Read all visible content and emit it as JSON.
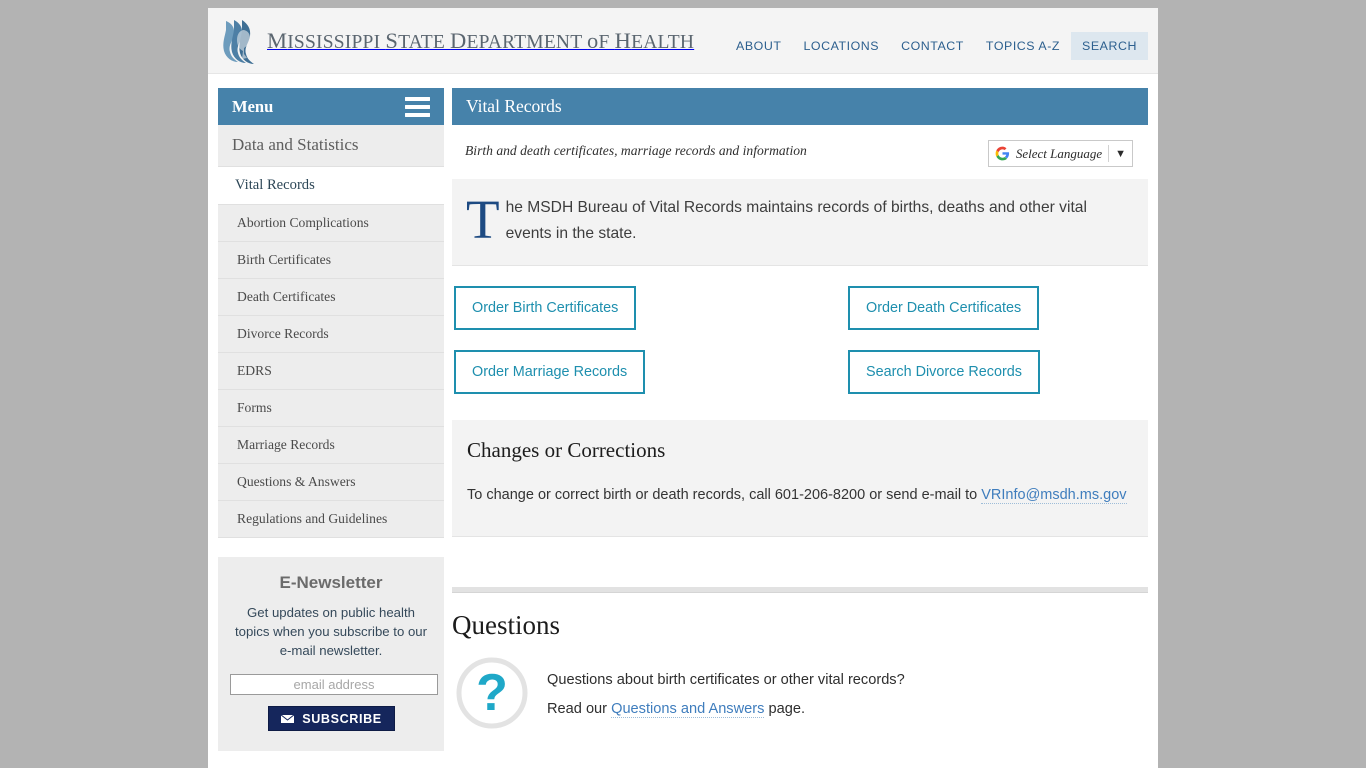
{
  "header": {
    "brand": "Mississippi State Department of Health",
    "nav": [
      {
        "label": "ABOUT",
        "active": false
      },
      {
        "label": "LOCATIONS",
        "active": false
      },
      {
        "label": "CONTACT",
        "active": false
      },
      {
        "label": "TOPICS A-Z",
        "active": false
      },
      {
        "label": "SEARCH",
        "active": true
      }
    ]
  },
  "sidebar": {
    "menu_label": "Menu",
    "section_title": "Data and Statistics",
    "items": [
      {
        "label": "Vital Records",
        "current": true
      },
      {
        "label": "Abortion Complications",
        "current": false
      },
      {
        "label": "Birth Certificates",
        "current": false
      },
      {
        "label": "Death Certificates",
        "current": false
      },
      {
        "label": "Divorce Records",
        "current": false
      },
      {
        "label": "EDRS",
        "current": false
      },
      {
        "label": "Forms",
        "current": false
      },
      {
        "label": "Marriage Records",
        "current": false
      },
      {
        "label": "Questions & Answers",
        "current": false
      },
      {
        "label": "Regulations and Guidelines",
        "current": false
      }
    ],
    "newsletter": {
      "title": "E-Newsletter",
      "description": "Get updates on public health topics when you subscribe to our e-mail newsletter.",
      "email_placeholder": "email address",
      "email_value": "",
      "subscribe_label": "SUBSCRIBE"
    }
  },
  "main": {
    "title": "Vital Records",
    "subhead": "Birth and death certificates, marriage records and information",
    "translate": {
      "label": "Select Language",
      "caret": "▼"
    },
    "intro": {
      "dropcap": "T",
      "text": "he MSDH Bureau of Vital Records maintains records of births, deaths and other vital events in the state."
    },
    "actions": [
      {
        "label": "Order Birth Certificates",
        "column": "left"
      },
      {
        "label": "Order Death Certificates",
        "column": "right"
      },
      {
        "label": "Order Marriage Records",
        "column": "left"
      },
      {
        "label": "Search Divorce Records",
        "column": "right"
      }
    ],
    "corrections": {
      "heading": "Changes or Corrections",
      "body": "To change or correct birth or death records, call 601-206-8200 or send e-mail to ",
      "email_link": "VRInfo@msdh.ms.gov"
    },
    "questions": {
      "heading": "Questions",
      "line1": "Questions about birth certificates or other vital records?",
      "line2_before": "Read our ",
      "line2_link": "Questions and Answers",
      "line2_after": " page."
    }
  },
  "colors": {
    "brand_blue": "#4682aa",
    "accent_teal": "#1e8fae",
    "link_blue": "#3f7dbd",
    "nav_blue": "#2c5f8e",
    "subscribe_navy": "#15265c",
    "page_bg": "#b3b3b3"
  }
}
